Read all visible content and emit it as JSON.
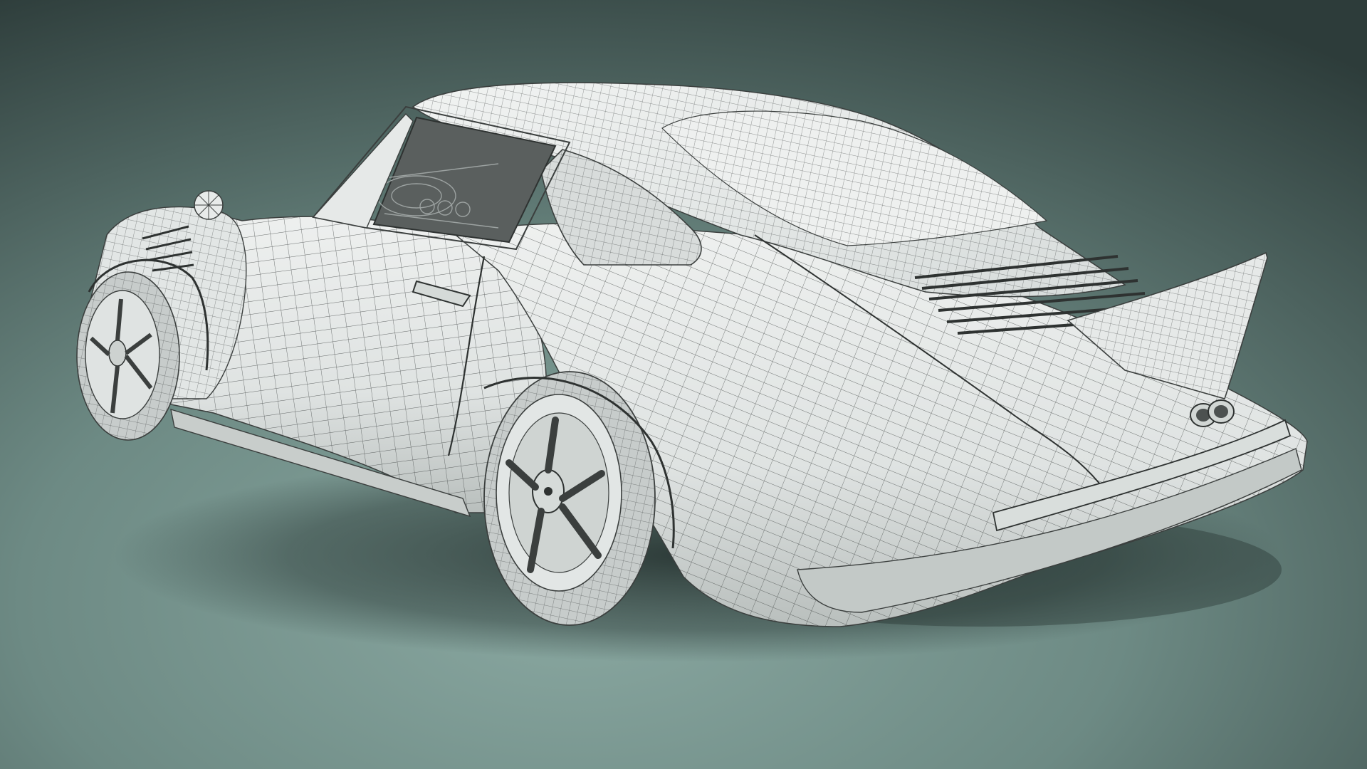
{
  "scene": {
    "subject": "car-wireframe-render",
    "colors": {
      "background_light": "#7d9a94",
      "background_mid": "#5f7a75",
      "background_dark": "#2f3f3d",
      "body_fill": "#e4e7e6",
      "body_shade": "#bcc2c0",
      "wire": "#3b3f3e",
      "tire": "#c9cecd",
      "glass": "#575c5b",
      "shadow": "#22302e"
    },
    "icons": {
      "wheels": "wheel-icon",
      "mirror": "mirror-icon",
      "exhaust": "exhaust-icon"
    }
  }
}
